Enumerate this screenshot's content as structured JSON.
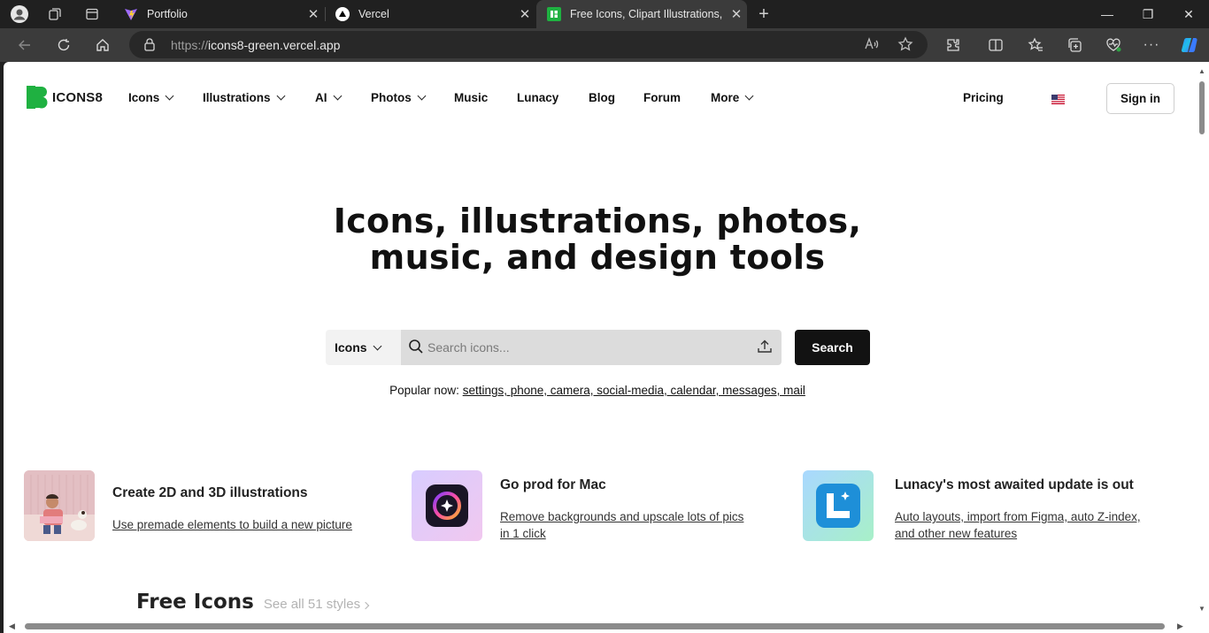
{
  "browser": {
    "tabs": [
      {
        "title": "Portfolio",
        "close": "✕"
      },
      {
        "title": "Vercel",
        "close": "✕"
      },
      {
        "title": "Free Icons, Clipart Illustrations, Photos, and Music",
        "close": "✕"
      }
    ],
    "new_tab": "+",
    "url_prefix": "https://",
    "url_host": "icons8-green.vercel.app",
    "window_controls": {
      "minimize": "—",
      "maximize": "❐",
      "close": "✕"
    }
  },
  "site": {
    "logo_text": "ICONS8",
    "nav": {
      "icons": "Icons",
      "illustrations": "Illustrations",
      "ai": "AI",
      "photos": "Photos",
      "music": "Music",
      "lunacy": "Lunacy",
      "blog": "Blog",
      "forum": "Forum",
      "more": "More",
      "pricing": "Pricing",
      "signin": "Sign in"
    },
    "hero": {
      "line1": "Icons, illustrations, photos,",
      "line2": "music, and design tools"
    },
    "search": {
      "type": "Icons",
      "placeholder": "Search icons...",
      "button": "Search"
    },
    "popular": {
      "label": "Popular now:",
      "links": "settings, phone, camera, social-media, calendar, messages, mail"
    },
    "promos": [
      {
        "title": "Create 2D and 3D illustrations",
        "link": "Use premade elements to build a new picture"
      },
      {
        "title": "Go prod for Mac",
        "link1": "Remove backgrounds and upscale lots of pics",
        "link2": "in 1 click"
      },
      {
        "title": "Lunacy's most awaited update is out",
        "link1": "Auto layouts, import from Figma, auto Z-index,",
        "link2": "and other new features"
      }
    ],
    "free_icons": {
      "heading": "Free Icons",
      "see_all": "See all 51 styles"
    }
  },
  "colors": {
    "brand_green": "#1fb141",
    "page_bg": "#ffffff",
    "chrome_bg": "#202020",
    "toolbar_bg": "#3b3b3b",
    "search_btn": "#121212"
  }
}
